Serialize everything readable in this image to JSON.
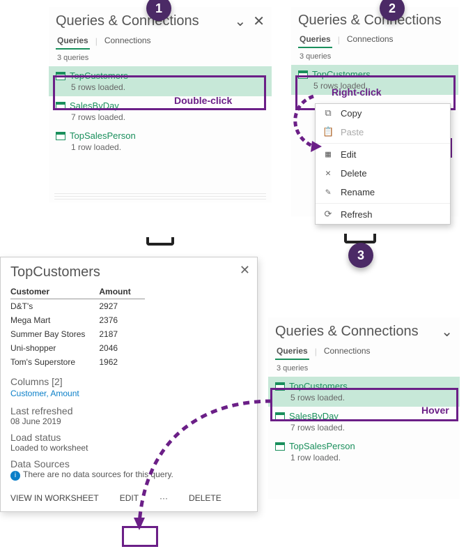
{
  "panel1": {
    "title": "Queries & Connections",
    "tabs": {
      "queries": "Queries",
      "connections": "Connections"
    },
    "count": "3 queries",
    "queries": [
      {
        "name": "TopCustomers",
        "status": "5 rows loaded."
      },
      {
        "name": "SalesByDay",
        "status": "7 rows loaded."
      },
      {
        "name": "TopSalesPerson",
        "status": "1 row loaded."
      }
    ],
    "anno": "Double-click"
  },
  "panel2": {
    "title": "Queries & Connections",
    "tabs": {
      "queries": "Queries",
      "connections": "Connections"
    },
    "count": "3 queries",
    "queries": [
      {
        "name": "TopCustomers",
        "status": "5 rows loaded."
      }
    ],
    "anno": "Right-click",
    "menu": {
      "copy": "Copy",
      "paste": "Paste",
      "edit": "Edit",
      "delete": "Delete",
      "rename": "Rename",
      "refresh": "Refresh"
    }
  },
  "panel3": {
    "title": "Queries & Connections",
    "tabs": {
      "queries": "Queries",
      "connections": "Connections"
    },
    "count": "3 queries",
    "queries": [
      {
        "name": "TopCustomers",
        "status": "5 rows loaded."
      },
      {
        "name": "SalesByDay",
        "status": "7 rows loaded."
      },
      {
        "name": "TopSalesPerson",
        "status": "1 row loaded."
      }
    ],
    "anno": "Hover"
  },
  "tooltip": {
    "title": "TopCustomers",
    "th0": "Customer",
    "th1": "Amount",
    "rows": [
      {
        "c": "D&T's",
        "a": "2927"
      },
      {
        "c": "Mega Mart",
        "a": "2376"
      },
      {
        "c": "Summer Bay Stores",
        "a": "2187"
      },
      {
        "c": "Uni-shopper",
        "a": "2046"
      },
      {
        "c": "Tom's Superstore",
        "a": "1962"
      }
    ],
    "columns_label": "Columns [2]",
    "columns_val": "Customer, Amount",
    "refreshed_label": "Last refreshed",
    "refreshed_val": "08 June 2019",
    "load_label": "Load status",
    "load_val": "Loaded to worksheet",
    "sources_label": "Data Sources",
    "sources_val": "There are no data sources for this query.",
    "view": "VIEW IN WORKSHEET",
    "edit": "EDIT",
    "more": "···",
    "delete": "DELETE"
  },
  "badges": {
    "one": "1",
    "two": "2",
    "three": "3"
  }
}
